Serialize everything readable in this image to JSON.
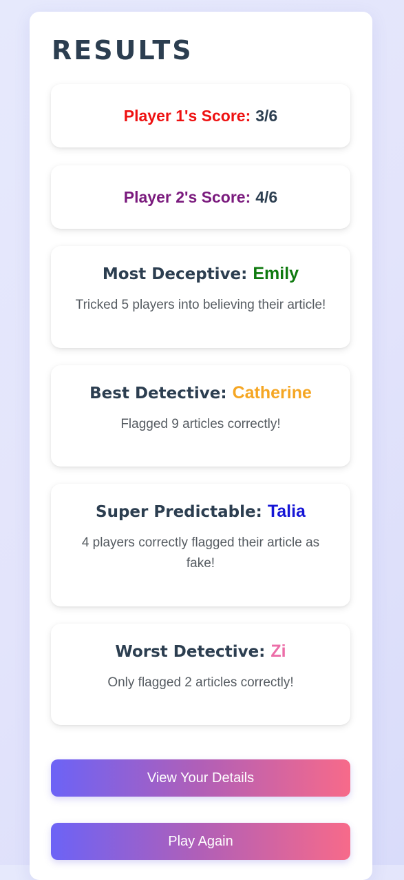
{
  "page": {
    "title": "RESULTS"
  },
  "scores": [
    {
      "label": "Player 1's Score:",
      "value": "3/6",
      "color": "#ee1111"
    },
    {
      "label": "Player 2's Score:",
      "value": "4/6",
      "color": "#7a1a7d"
    }
  ],
  "awards": [
    {
      "heading": "Most Deceptive:",
      "name": "Emily",
      "name_color": "#0f7a0f",
      "description": "Tricked 5 players into believing their article!"
    },
    {
      "heading": "Best Detective:",
      "name": "Catherine",
      "name_color": "#f5a623",
      "description": "Flagged 9 articles correctly!"
    },
    {
      "heading": "Super Predictable:",
      "name": "Talia",
      "name_color": "#1515d6",
      "description": "4 players correctly flagged their article as fake!"
    },
    {
      "heading": "Worst Detective:",
      "name": "Zi",
      "name_color": "#ec6ea8",
      "description": "Only flagged 2 articles correctly!"
    }
  ],
  "buttons": {
    "view_details": "View Your Details",
    "play_again": "Play Again"
  },
  "colors": {
    "heading_text": "#2c3e50",
    "button_gradient_start": "#6c63f6",
    "button_gradient_end": "#f76a8a"
  }
}
